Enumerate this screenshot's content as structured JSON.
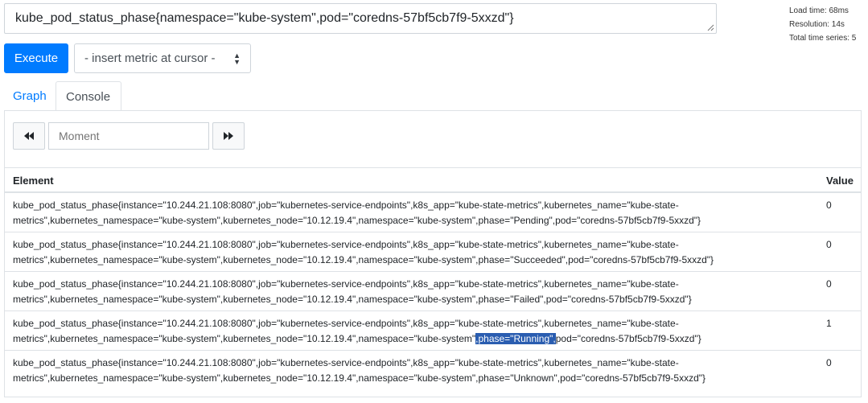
{
  "query": {
    "value": "kube_pod_status_phase{namespace=\"kube-system\",pod=\"coredns-57bf5cb7f9-5xxzd\"}"
  },
  "stats": {
    "load_time": "Load time: 68ms",
    "resolution": "Resolution: 14s",
    "total_series": "Total time series: 5"
  },
  "toolbar": {
    "execute_label": "Execute",
    "metric_select_value": "- insert metric at cursor -"
  },
  "tabs": [
    {
      "label": "Graph",
      "active": false
    },
    {
      "label": "Console",
      "active": true
    }
  ],
  "console": {
    "moment_placeholder": "Moment",
    "columns": {
      "element": "Element",
      "value": "Value"
    },
    "rows": [
      {
        "line1": "kube_pod_status_phase{instance=\"10.244.21.108:8080\",job=\"kubernetes-service-endpoints\",k8s_app=\"kube-state-metrics\",kubernetes_name=\"kube-state-",
        "line2_pre": "metrics\",kubernetes_namespace=\"kube-system\",kubernetes_node=\"10.12.19.4\",namespace=\"kube-system\",",
        "line2_sel": "",
        "line2_post": "phase=\"Pending\",pod=\"coredns-57bf5cb7f9-5xxzd\"}",
        "value": "0"
      },
      {
        "line1": "kube_pod_status_phase{instance=\"10.244.21.108:8080\",job=\"kubernetes-service-endpoints\",k8s_app=\"kube-state-metrics\",kubernetes_name=\"kube-state-",
        "line2_pre": "metrics\",kubernetes_namespace=\"kube-system\",kubernetes_node=\"10.12.19.4\",namespace=\"kube-system\",",
        "line2_sel": "",
        "line2_post": "phase=\"Succeeded\",pod=\"coredns-57bf5cb7f9-5xxzd\"}",
        "value": "0"
      },
      {
        "line1": "kube_pod_status_phase{instance=\"10.244.21.108:8080\",job=\"kubernetes-service-endpoints\",k8s_app=\"kube-state-metrics\",kubernetes_name=\"kube-state-",
        "line2_pre": "metrics\",kubernetes_namespace=\"kube-system\",kubernetes_node=\"10.12.19.4\",namespace=\"kube-system\",",
        "line2_sel": "",
        "line2_post": "phase=\"Failed\",pod=\"coredns-57bf5cb7f9-5xxzd\"}",
        "value": "0"
      },
      {
        "line1": "kube_pod_status_phase{instance=\"10.244.21.108:8080\",job=\"kubernetes-service-endpoints\",k8s_app=\"kube-state-metrics\",kubernetes_name=\"kube-state-",
        "line2_pre": "metrics\",kubernetes_namespace=\"kube-system\",kubernetes_node=\"10.12.19.4\",namespace=\"kube-system\"",
        "line2_sel": ",phase=\"Running\",",
        "line2_post": "pod=\"coredns-57bf5cb7f9-5xxzd\"}",
        "value": "1"
      },
      {
        "line1": "kube_pod_status_phase{instance=\"10.244.21.108:8080\",job=\"kubernetes-service-endpoints\",k8s_app=\"kube-state-metrics\",kubernetes_name=\"kube-state-",
        "line2_pre": "metrics\",kubernetes_namespace=\"kube-system\",kubernetes_node=\"10.12.19.4\",namespace=\"kube-system\",",
        "line2_sel": "",
        "line2_post": "phase=\"Unknown\",pod=\"coredns-57bf5cb7f9-5xxzd\"}",
        "value": "0"
      }
    ]
  },
  "colors": {
    "primary": "#007bff",
    "selection": "#2a5db0"
  },
  "icons": {
    "prev": "rewind-icon",
    "next": "fast-forward-icon",
    "select_arrows": "up-down-arrows-icon"
  }
}
